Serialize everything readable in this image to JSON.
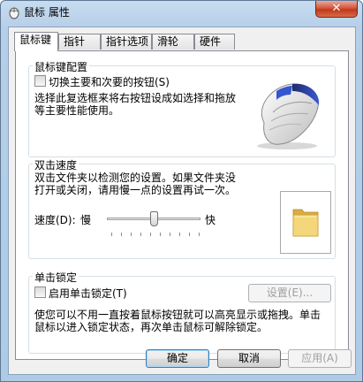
{
  "window": {
    "title": "鼠标 属性",
    "close_symbol": "✕"
  },
  "tabs": [
    {
      "label": "鼠标键",
      "active": true
    },
    {
      "label": "指针",
      "active": false
    },
    {
      "label": "指针选项",
      "active": false
    },
    {
      "label": "滑轮",
      "active": false
    },
    {
      "label": "硬件",
      "active": false
    }
  ],
  "button_config": {
    "title": "鼠标键配置",
    "swap_checkbox_label": "切换主要和次要的按钮(S)",
    "swap_checked": false,
    "description_line1": "选择此复选框来将右按钮设成如选择和拖放",
    "description_line2": "等主要性能使用。"
  },
  "double_click": {
    "title": "双击速度",
    "description_line1": "双击文件夹以检测您的设置。如果文件夹没",
    "description_line2": "打开或关闭，请用慢一点的设置再试一次。",
    "speed_label": "速度(D):",
    "slow_label": "慢",
    "fast_label": "快",
    "speed_level": 0.5
  },
  "click_lock": {
    "title": "单击锁定",
    "checkbox_label": "启用单击锁定(T)",
    "checked": false,
    "settings_button": "设置(E)...",
    "description_line1": "使您可以不用一直按着鼠标按钮就可以高亮显示或拖拽。单击",
    "description_line2": "鼠标以进入锁定状态，再次单击鼠标可解除锁定。"
  },
  "footer": {
    "ok": "确定",
    "cancel": "取消",
    "apply": "应用(A)"
  },
  "colors": {
    "accent": "#3c7fb1",
    "mouse_highlight": "#2a52c8",
    "folder": "#e8c35a"
  }
}
